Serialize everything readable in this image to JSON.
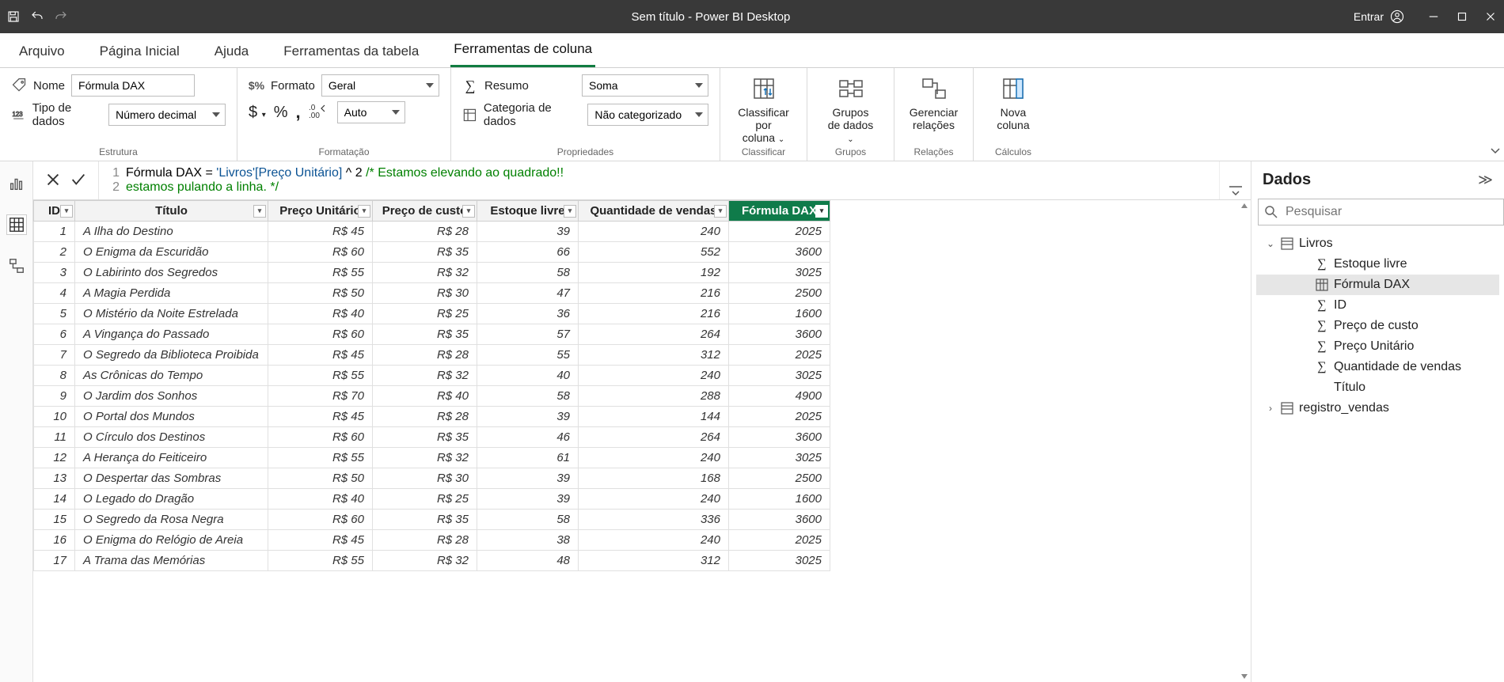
{
  "titlebar": {
    "title": "Sem título - Power BI Desktop",
    "signin": "Entrar"
  },
  "menu": {
    "tabs": [
      "Arquivo",
      "Página Inicial",
      "Ajuda",
      "Ferramentas da tabela",
      "Ferramentas de coluna"
    ],
    "active_index": 4
  },
  "ribbon": {
    "estrutura": {
      "nome_label": "Nome",
      "nome_value": "Fórmula DAX",
      "tipodados_label": "Tipo de dados",
      "tipodados_value": "Número decimal",
      "group_label": "Estrutura"
    },
    "formatacao": {
      "formato_label": "Formato",
      "formato_value": "Geral",
      "auto_value": "Auto",
      "group_label": "Formatação"
    },
    "propriedades": {
      "resumo_label": "Resumo",
      "resumo_value": "Soma",
      "categoria_label": "Categoria de dados",
      "categoria_value": "Não categorizado",
      "group_label": "Propriedades"
    },
    "classificar": {
      "btn": "Classificar por coluna",
      "group_label": "Classificar"
    },
    "grupos": {
      "btn": "Grupos de dados",
      "group_label": "Grupos"
    },
    "relacoes": {
      "btn": "Gerenciar relações",
      "group_label": "Relações"
    },
    "calculos": {
      "btn": "Nova coluna",
      "group_label": "Cálculos"
    }
  },
  "formula": {
    "line1_num": "1",
    "line2_num": "2",
    "prefix": "Fórmula DAX = ",
    "ref": "'Livros'[Preço Unitário]",
    "op": " ^ ",
    "val": "2",
    "comment1": " /* Estamos elevando ao quadrado!!",
    "comment2": "estamos pulando a linha. */"
  },
  "table": {
    "headers": [
      "ID",
      "Título",
      "Preço Unitário",
      "Preço de custo",
      "Estoque livre",
      "Quantidade de vendas",
      "Fórmula DAX"
    ],
    "selected_col_index": 6,
    "rows": [
      {
        "id": "1",
        "titulo": "A Ilha do Destino",
        "pu": "R$ 45",
        "pc": "R$ 28",
        "est": "39",
        "qv": "240",
        "fx": "2025"
      },
      {
        "id": "2",
        "titulo": "O Enigma da Escuridão",
        "pu": "R$ 60",
        "pc": "R$ 35",
        "est": "66",
        "qv": "552",
        "fx": "3600"
      },
      {
        "id": "3",
        "titulo": "O Labirinto dos Segredos",
        "pu": "R$ 55",
        "pc": "R$ 32",
        "est": "58",
        "qv": "192",
        "fx": "3025"
      },
      {
        "id": "4",
        "titulo": "A Magia Perdida",
        "pu": "R$ 50",
        "pc": "R$ 30",
        "est": "47",
        "qv": "216",
        "fx": "2500"
      },
      {
        "id": "5",
        "titulo": "O Mistério da Noite Estrelada",
        "pu": "R$ 40",
        "pc": "R$ 25",
        "est": "36",
        "qv": "216",
        "fx": "1600"
      },
      {
        "id": "6",
        "titulo": "A Vingança do Passado",
        "pu": "R$ 60",
        "pc": "R$ 35",
        "est": "57",
        "qv": "264",
        "fx": "3600"
      },
      {
        "id": "7",
        "titulo": "O Segredo da Biblioteca Proibida",
        "pu": "R$ 45",
        "pc": "R$ 28",
        "est": "55",
        "qv": "312",
        "fx": "2025"
      },
      {
        "id": "8",
        "titulo": "As Crônicas do Tempo",
        "pu": "R$ 55",
        "pc": "R$ 32",
        "est": "40",
        "qv": "240",
        "fx": "3025"
      },
      {
        "id": "9",
        "titulo": "O Jardim dos Sonhos",
        "pu": "R$ 70",
        "pc": "R$ 40",
        "est": "58",
        "qv": "288",
        "fx": "4900"
      },
      {
        "id": "10",
        "titulo": "O Portal dos Mundos",
        "pu": "R$ 45",
        "pc": "R$ 28",
        "est": "39",
        "qv": "144",
        "fx": "2025"
      },
      {
        "id": "11",
        "titulo": "O Círculo dos Destinos",
        "pu": "R$ 60",
        "pc": "R$ 35",
        "est": "46",
        "qv": "264",
        "fx": "3600"
      },
      {
        "id": "12",
        "titulo": "A Herança do Feiticeiro",
        "pu": "R$ 55",
        "pc": "R$ 32",
        "est": "61",
        "qv": "240",
        "fx": "3025"
      },
      {
        "id": "13",
        "titulo": "O Despertar das Sombras",
        "pu": "R$ 50",
        "pc": "R$ 30",
        "est": "39",
        "qv": "168",
        "fx": "2500"
      },
      {
        "id": "14",
        "titulo": "O Legado do Dragão",
        "pu": "R$ 40",
        "pc": "R$ 25",
        "est": "39",
        "qv": "240",
        "fx": "1600"
      },
      {
        "id": "15",
        "titulo": "O Segredo da Rosa Negra",
        "pu": "R$ 60",
        "pc": "R$ 35",
        "est": "58",
        "qv": "336",
        "fx": "3600"
      },
      {
        "id": "16",
        "titulo": "O Enigma do Relógio de Areia",
        "pu": "R$ 45",
        "pc": "R$ 28",
        "est": "38",
        "qv": "240",
        "fx": "2025"
      },
      {
        "id": "17",
        "titulo": "A Trama das Memórias",
        "pu": "R$ 55",
        "pc": "R$ 32",
        "est": "48",
        "qv": "312",
        "fx": "3025"
      }
    ]
  },
  "rightpanel": {
    "title": "Dados",
    "search_placeholder": "Pesquisar",
    "tables": [
      {
        "name": "Livros",
        "expanded": true,
        "fields": [
          {
            "name": "Estoque livre",
            "type": "sum"
          },
          {
            "name": "Fórmula DAX",
            "type": "calc",
            "selected": true
          },
          {
            "name": "ID",
            "type": "sum"
          },
          {
            "name": "Preço de custo",
            "type": "sum"
          },
          {
            "name": "Preço Unitário",
            "type": "sum"
          },
          {
            "name": "Quantidade de vendas",
            "type": "sum"
          },
          {
            "name": "Título",
            "type": "text"
          }
        ]
      },
      {
        "name": "registro_vendas",
        "expanded": false
      }
    ]
  }
}
